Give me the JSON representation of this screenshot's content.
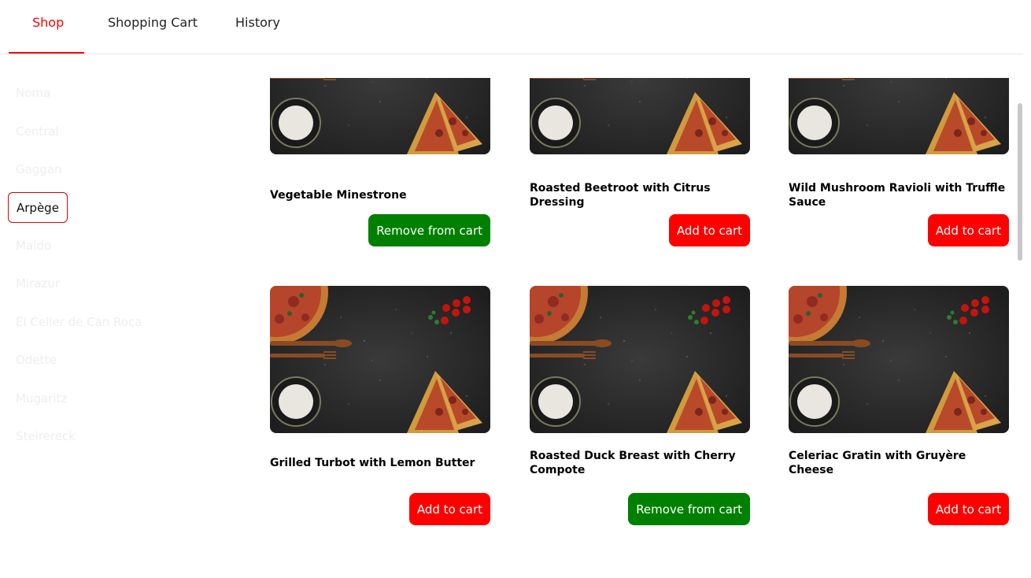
{
  "tabs": [
    {
      "label": "Shop",
      "active": true
    },
    {
      "label": "Shopping Cart",
      "active": false
    },
    {
      "label": "History",
      "active": false
    }
  ],
  "sidebar": {
    "items": [
      {
        "label": "Noma",
        "active": false
      },
      {
        "label": "Central",
        "active": false
      },
      {
        "label": "Gaggan",
        "active": false
      },
      {
        "label": "Arpège",
        "active": true
      },
      {
        "label": "Maido",
        "active": false
      },
      {
        "label": "Mirazur",
        "active": false
      },
      {
        "label": "El Celler de Can Roca",
        "active": false
      },
      {
        "label": "Odette",
        "active": false
      },
      {
        "label": "Mugaritz",
        "active": false
      },
      {
        "label": "Steirereck",
        "active": false
      }
    ]
  },
  "products": [
    {
      "name": "Vegetable Minestrone",
      "button": "Remove from cart",
      "in_cart": true
    },
    {
      "name": "Roasted Beetroot with Citrus Dressing",
      "button": "Add to cart",
      "in_cart": false
    },
    {
      "name": "Wild Mushroom Ravioli with Truffle Sauce",
      "button": "Add to cart",
      "in_cart": false
    },
    {
      "name": "Grilled Turbot with Lemon Butter",
      "button": "Add to cart",
      "in_cart": false
    },
    {
      "name": "Roasted Duck Breast with Cherry Compote",
      "button": "Remove from cart",
      "in_cart": true
    },
    {
      "name": "Celeriac Gratin with Gruyère Cheese",
      "button": "Add to cart",
      "in_cart": false
    }
  ],
  "colors": {
    "accent": "#ff0000",
    "add_button": "#ff0000",
    "remove_button": "#008000",
    "sidebar_inactive_text": "#eeeeee"
  }
}
